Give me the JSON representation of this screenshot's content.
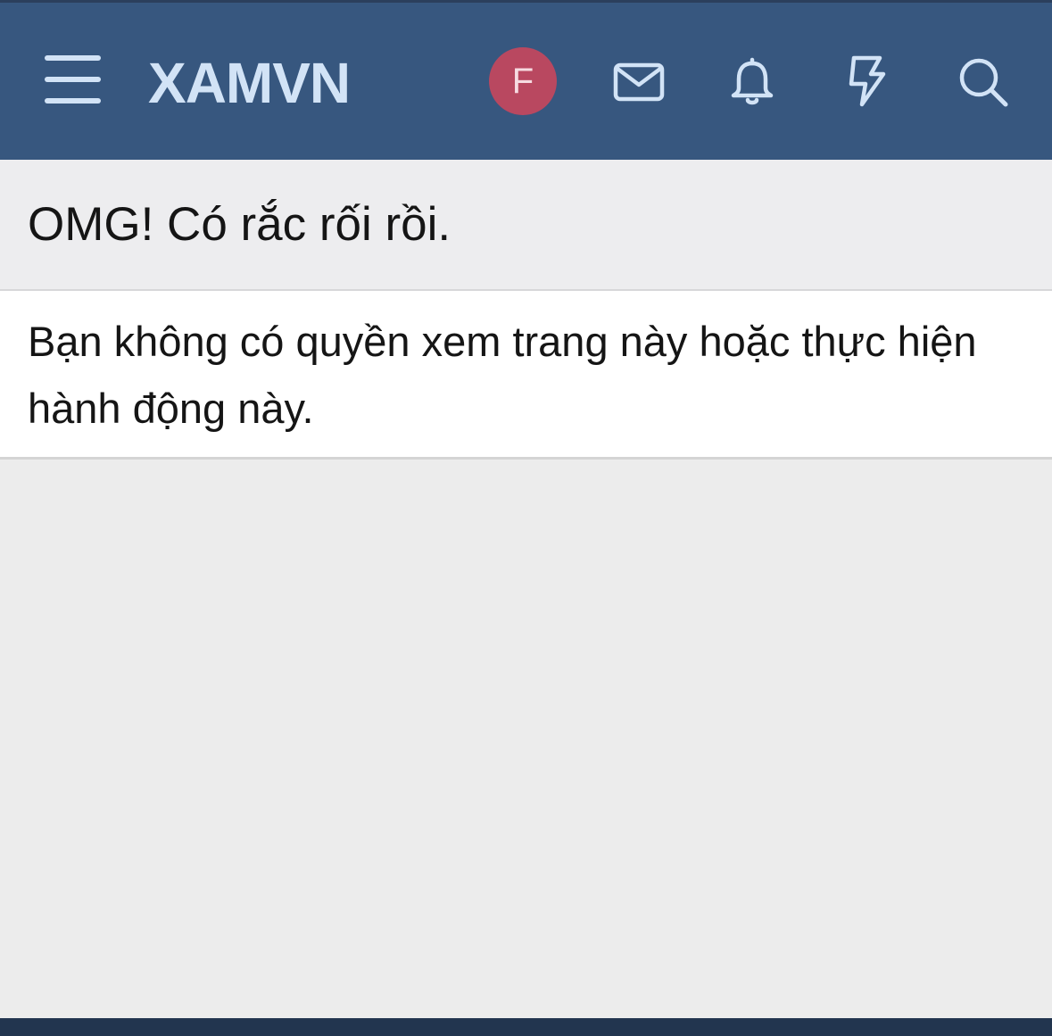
{
  "header": {
    "logo": "XAMVN",
    "avatar_letter": "F",
    "icons": {
      "menu": "hamburger-menu-icon",
      "inbox": "envelope-icon",
      "alerts": "bell-icon",
      "whats_new": "lightning-bolt-icon",
      "search": "search-icon"
    },
    "colors": {
      "background": "#37577f",
      "foreground": "#d2e3f6",
      "avatar": "#b94860"
    }
  },
  "page": {
    "title": "OMG! Có rắc rối rồi.",
    "message": "Bạn không có quyền xem trang này hoặc thực hiện hành động này."
  }
}
